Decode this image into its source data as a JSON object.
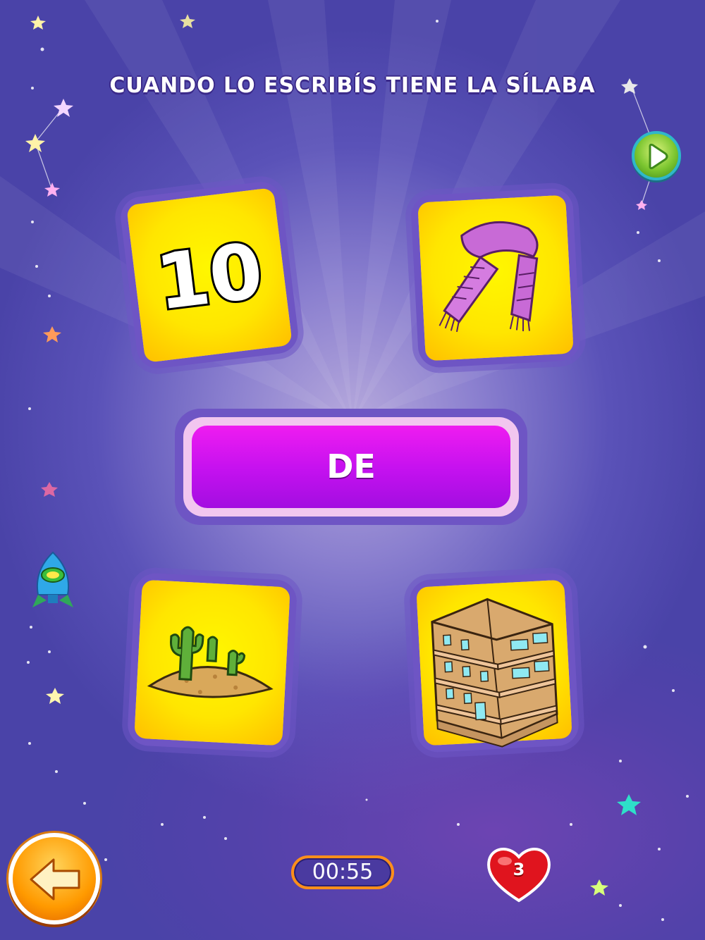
{
  "game": {
    "instruction": "CUANDO LO ESCRIBÍS TIENE LA SÍLABA",
    "syllable": "DE",
    "timer": "00:55",
    "lives": "3"
  },
  "cards": [
    {
      "name": "card-number-ten",
      "label": "10"
    },
    {
      "name": "card-scarf"
    },
    {
      "name": "card-desert"
    },
    {
      "name": "card-building"
    }
  ],
  "icons": {
    "next": "play-arrow-icon",
    "back": "back-arrow-icon",
    "lives": "heart-icon",
    "decor": "rocket-icon"
  },
  "colors": {
    "background": "#5a52b8",
    "card_face": "#ffe600",
    "syllable_button": "#c311ef",
    "timer_border": "#ff8f1a",
    "next_button": "#7cc630",
    "back_button": "#ff9a00"
  }
}
